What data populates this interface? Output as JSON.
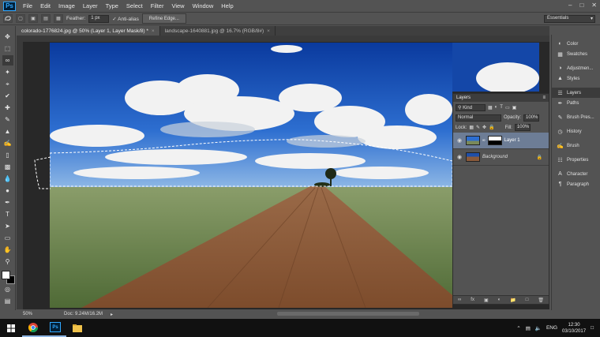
{
  "app": {
    "logo": "Ps",
    "menu": [
      "File",
      "Edit",
      "Image",
      "Layer",
      "Type",
      "Select",
      "Filter",
      "View",
      "Window",
      "Help"
    ]
  },
  "options_bar": {
    "feather_label": "Feather:",
    "feather_value": "1 px",
    "anti_alias_label": "Anti-alias",
    "refine_edge_label": "Refine Edge...",
    "workspace": "Essentials"
  },
  "tabs": [
    {
      "label": "colorado-1776824.jpg @ 50% (Layer 1, Layer Mask/8) *",
      "active": true
    },
    {
      "label": "landscape-1640881.jpg @ 16.7% (RGB/8#)",
      "active": false
    }
  ],
  "status": {
    "zoom": "50%",
    "doc": "Doc: 9.24M/16.2M"
  },
  "dock": {
    "group1": [
      {
        "label": "Color",
        "icon": "color-wheel-icon"
      },
      {
        "label": "Swatches",
        "icon": "swatches-icon"
      }
    ],
    "group2": [
      {
        "label": "Adjustmen...",
        "icon": "adjustments-icon"
      },
      {
        "label": "Styles",
        "icon": "styles-icon"
      }
    ],
    "group3": [
      {
        "label": "Layers",
        "icon": "layers-icon",
        "active": true
      },
      {
        "label": "Paths",
        "icon": "paths-icon"
      }
    ],
    "group4": [
      {
        "label": "Brush Pres...",
        "icon": "brush-presets-icon"
      }
    ],
    "group5": [
      {
        "label": "History",
        "icon": "history-icon"
      }
    ],
    "group6": [
      {
        "label": "Brush",
        "icon": "brush-icon"
      }
    ],
    "group7": [
      {
        "label": "Properties",
        "icon": "properties-icon"
      }
    ],
    "group8": [
      {
        "label": "Character",
        "icon": "character-icon"
      },
      {
        "label": "Paragraph",
        "icon": "paragraph-icon"
      }
    ]
  },
  "layers_panel": {
    "title": "Layers",
    "filter_kind": "Kind",
    "blend_mode": "Normal",
    "opacity_label": "Opacity:",
    "opacity_value": "100%",
    "lock_label": "Lock:",
    "fill_label": "Fill:",
    "fill_value": "100%",
    "layers": [
      {
        "name": "Layer 1",
        "selected": true
      },
      {
        "name": "Background",
        "selected": false
      }
    ]
  },
  "taskbar": {
    "language": "ENG",
    "time": "12:30",
    "date": "03/10/2017"
  },
  "colors": {
    "ui_gray": "#535353",
    "selected_layer": "#6d7d96",
    "sky": "#1546a8",
    "road": "#8a5a3a",
    "grass": "#6f8650"
  }
}
